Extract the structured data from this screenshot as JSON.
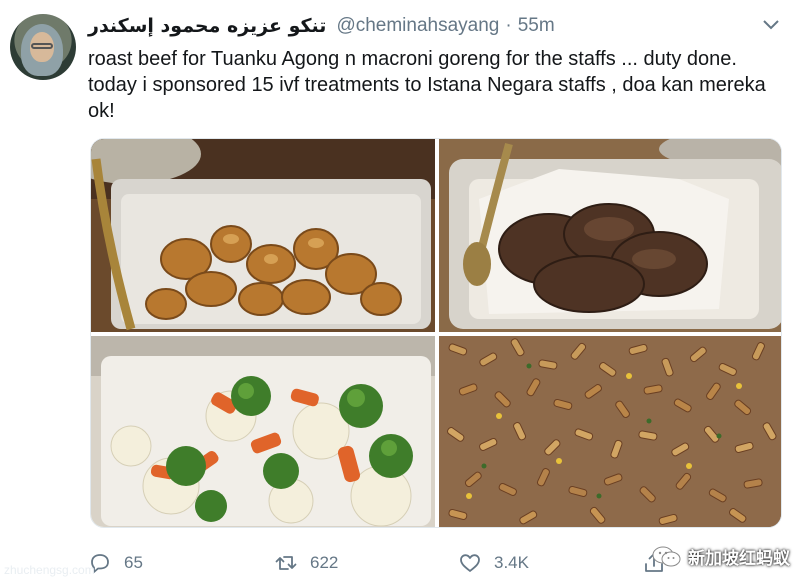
{
  "tweet": {
    "display_name": "تنكو عزيزه محمود إسكندر",
    "handle": "@cheminahsayang",
    "separator": "·",
    "time": "55m",
    "text_lines": [
      "roast beef for Tuanku Agong n macroni goreng for the staffs ... duty done.",
      "today i sponsored 15 ivf treatments to Istana Negara staffs , doa kan mereka",
      "ok!"
    ]
  },
  "media": {
    "photos": [
      {
        "subject": "roast-potatoes"
      },
      {
        "subject": "roast-beef"
      },
      {
        "subject": "steamed-vegetables"
      },
      {
        "subject": "macaroni-goreng"
      }
    ]
  },
  "actions": {
    "reply_count": "65",
    "retweet_count": "622",
    "like_count": "3.4K"
  },
  "watermark": {
    "bottom_text": "新加坡红蚂蚁",
    "left_text": "zhuchengsg.com"
  },
  "colors": {
    "text": "#14171a",
    "secondary": "#657786",
    "border": "#e1e8ed"
  },
  "icons": [
    "chevron-down-icon",
    "reply-icon",
    "retweet-icon",
    "like-icon",
    "share-icon",
    "wechat-icon"
  ]
}
